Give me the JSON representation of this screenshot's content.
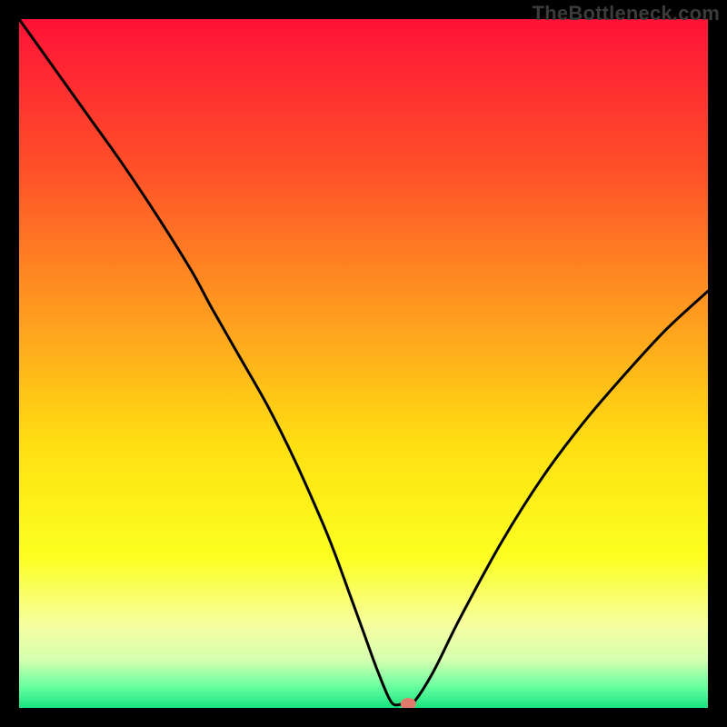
{
  "watermark": "TheBottleneck.com",
  "chart_data": {
    "type": "line",
    "title": "",
    "xlabel": "",
    "ylabel": "",
    "xlim": [
      0,
      100
    ],
    "ylim": [
      0,
      100
    ],
    "series": [
      {
        "name": "curve",
        "x": [
          0,
          5,
          10,
          15,
          20,
          25,
          28,
          32,
          36,
          40,
          44,
          46,
          48,
          50,
          52,
          54,
          55.5,
          57,
          60,
          64,
          70,
          76,
          82,
          88,
          94,
          100
        ],
        "y": [
          100,
          93,
          86,
          79,
          71.5,
          63.5,
          58,
          51,
          44,
          36,
          27,
          22,
          16.5,
          11,
          5.5,
          0.9,
          0.5,
          0.5,
          5,
          13,
          24,
          33.5,
          41.5,
          48.5,
          55,
          60.5
        ]
      }
    ],
    "marker": {
      "x": 56.5,
      "y": 0.6
    },
    "gradient_stops": [
      {
        "offset": 0,
        "color": "#ff1237"
      },
      {
        "offset": 22,
        "color": "#ff5129"
      },
      {
        "offset": 45,
        "color": "#ffa31e"
      },
      {
        "offset": 62,
        "color": "#ffe011"
      },
      {
        "offset": 78,
        "color": "#fcff20"
      },
      {
        "offset": 88,
        "color": "#f6ffa0"
      },
      {
        "offset": 93,
        "color": "#d6ffb0"
      },
      {
        "offset": 97,
        "color": "#66ff9f"
      },
      {
        "offset": 100,
        "color": "#17e37f"
      }
    ]
  }
}
